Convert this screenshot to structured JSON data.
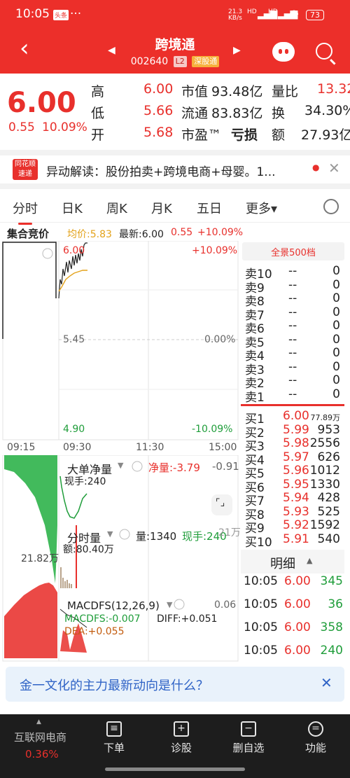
{
  "status": {
    "time": "10:05",
    "badge": "头条",
    "dots": "···",
    "speed": "21.3 KB/s",
    "signal1": "HD",
    "signal2": "HD",
    "battery": "73"
  },
  "header": {
    "title": "跨境通",
    "code": "002640",
    "level": "L2",
    "channel": "深股通"
  },
  "quote": {
    "price": "6.00",
    "change": "0.55",
    "change_pct": "10.09%",
    "high_label": "高",
    "high": "6.00",
    "low_label": "低",
    "low": "5.66",
    "open_label": "开",
    "open": "5.68",
    "mcap_label": "市值",
    "mcap": "93.48亿",
    "float_label": "流通",
    "float": "83.83亿",
    "pe_label": "市盈™",
    "pe": "亏损",
    "volratio_label": "量比",
    "volratio": "13.32",
    "turnover_label": "换",
    "turnover": "34.30%",
    "amount_label": "额",
    "amount": "27.93亿"
  },
  "news": {
    "logo_top": "同花顺",
    "logo_bottom": "速递",
    "text": "异动解读：股份拍卖+跨境电商+母婴。1..."
  },
  "tabs": [
    "分时",
    "日K",
    "周K",
    "月K",
    "五日",
    "更多▾"
  ],
  "chart": {
    "auction_label": "集合竞价",
    "avg_label": "均价:5.83",
    "latest_label": "最新:6.00",
    "chg": "0.55",
    "chg_pct": "+10.09%",
    "y_top": "6.00",
    "y_mid": "5.45",
    "y_bot": "4.90",
    "pct_top": "+10.09%",
    "pct_mid": "0.00%",
    "pct_bot": "-10.09%",
    "t1": "09:15",
    "t2": "09:30",
    "t3": "11:30",
    "t4": "15:00",
    "vol_side_label": "21.82万",
    "big_order": {
      "title": "大单净量",
      "net": "净量:-3.79",
      "right": "-0.91",
      "hand": "现手:240"
    },
    "time_vol": {
      "title": "分时量",
      "vol": "量:1340",
      "hand": "现手:240",
      "right": "21万",
      "amt": "额:80.40万"
    },
    "macd": {
      "title": "MACDFS(12,26,9)",
      "right": "0.06",
      "macd": "MACDFS:-0.007",
      "diff": "DIFF:+0.051",
      "dea": "DEA:+0.055"
    }
  },
  "orderbook": {
    "panorama": "全景500档",
    "asks": [
      {
        "label": "卖10",
        "price": "--",
        "vol": "0"
      },
      {
        "label": "卖9",
        "price": "--",
        "vol": "0"
      },
      {
        "label": "卖8",
        "price": "--",
        "vol": "0"
      },
      {
        "label": "卖7",
        "price": "--",
        "vol": "0"
      },
      {
        "label": "卖6",
        "price": "--",
        "vol": "0"
      },
      {
        "label": "卖5",
        "price": "--",
        "vol": "0"
      },
      {
        "label": "卖4",
        "price": "--",
        "vol": "0"
      },
      {
        "label": "卖3",
        "price": "--",
        "vol": "0"
      },
      {
        "label": "卖2",
        "price": "--",
        "vol": "0"
      },
      {
        "label": "卖1",
        "price": "--",
        "vol": "0"
      }
    ],
    "bids": [
      {
        "label": "买1",
        "price": "6.00",
        "vol": "77.89万"
      },
      {
        "label": "买2",
        "price": "5.99",
        "vol": "953"
      },
      {
        "label": "买3",
        "price": "5.98",
        "vol": "2556"
      },
      {
        "label": "买4",
        "price": "5.97",
        "vol": "626"
      },
      {
        "label": "买5",
        "price": "5.96",
        "vol": "1012"
      },
      {
        "label": "买6",
        "price": "5.95",
        "vol": "1330"
      },
      {
        "label": "买7",
        "price": "5.94",
        "vol": "428"
      },
      {
        "label": "买8",
        "price": "5.93",
        "vol": "525"
      },
      {
        "label": "买9",
        "price": "5.92",
        "vol": "1592"
      },
      {
        "label": "买10",
        "price": "5.91",
        "vol": "540"
      }
    ],
    "details_title": "明细",
    "details": [
      {
        "time": "10:05",
        "price": "6.00",
        "vol": "345"
      },
      {
        "time": "10:05",
        "price": "6.00",
        "vol": "36"
      },
      {
        "time": "10:05",
        "price": "6.00",
        "vol": "358"
      },
      {
        "time": "10:05",
        "price": "6.00",
        "vol": "240"
      }
    ]
  },
  "ai_question": "金一文化的主力最新动向是什么？",
  "bottom": {
    "sector_name": "互联网电商",
    "sector_pct": "0.36%",
    "nav": [
      "下单",
      "诊股",
      "删自选",
      "功能"
    ]
  },
  "colors": {
    "brand": "#ec2f2a",
    "up": "#e8302c",
    "down": "#1f9d3a"
  }
}
